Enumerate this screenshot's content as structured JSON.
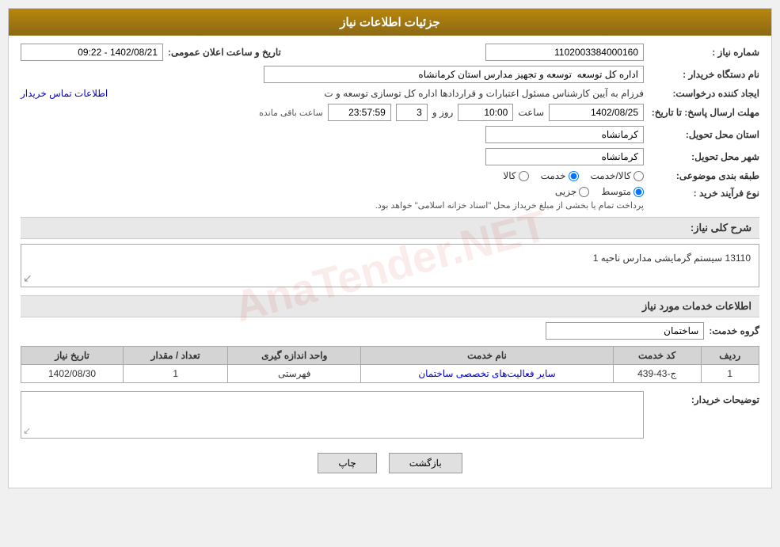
{
  "header": {
    "title": "جزئیات اطلاعات نیاز"
  },
  "fields": {
    "shomareNiaz_label": "شماره نیاز :",
    "shomareNiaz_value": "1102003384000160",
    "namDastgah_label": "نام دستگاه خریدار :",
    "namDastgah_value": "اداره کل توسعه  توسعه و تجهیز مدارس استان کرمانشاه",
    "ijadKonande_label": "ایجاد کننده درخواست:",
    "ijadKonande_value": "فرزام به آیین کارشناس مسئول اعتبارات و قراردادها اداره کل توسازی  توسعه و ت",
    "ijadKonande_link": "اطلاعات تماس خریدار",
    "mohlat_label": "مهلت ارسال پاسخ: تا تاریخ:",
    "date_value": "1402/08/25",
    "saat_label": "ساعت",
    "saat_value": "10:00",
    "rooz_label": "روز و",
    "rooz_value": "3",
    "remaining_label": "ساعت باقی مانده",
    "remaining_value": "23:57:59",
    "ostan_label": "استان محل تحویل:",
    "ostan_value": "کرمانشاه",
    "shahr_label": "شهر محل تحویل:",
    "shahr_value": "کرمانشاه",
    "tabaqe_label": "طبقه بندی موضوعی:",
    "tabaqe_kala": "کالا",
    "tabaqe_khedmat": "خدمت",
    "tabaqe_kala_khedmat": "کالا/خدمت",
    "tabaqe_selected": "khedmat",
    "noeFarayand_label": "نوع فرآیند خرید :",
    "noeFarayand_jozii": "جزیی",
    "noeFarayand_motavasset": "متوسط",
    "noeFarayand_note": "پرداخت تمام یا بخشی از مبلغ خریداز محل \"اسناد خزانه اسلامی\" خواهد بود.",
    "noeFarayand_selected": "motavasset",
    "tanhNiaz_label": "شرح کلی نیاز:",
    "tanhNiaz_value": "13110 سیستم گرمایشی مدارس ناحیه 1",
    "khAdamat_label": "اطلاعات خدمات مورد نیاز",
    "grohKhedmat_label": "گروه خدمت:",
    "grohKhedmat_value": "ساختمان",
    "table": {
      "headers": [
        "ردیف",
        "کد خدمت",
        "نام خدمت",
        "واحد اندازه گیری",
        "تعداد / مقدار",
        "تاریخ نیاز"
      ],
      "rows": [
        {
          "radif": "1",
          "kodKhedmat": "ج-43-439",
          "namKhedmat": "سایر فعالیت‌های تخصصی ساختمان",
          "vahed": "فهرستی",
          "tedad": "1",
          "tarikh": "1402/08/30"
        }
      ]
    },
    "tawzihKharidar_label": "توضیحات خریدار:",
    "tawzihKharidar_value": "",
    "tarikh_saat_elan_label": "تاریخ و ساعت اعلان عمومی:",
    "tarikh_saat_elan_value": "1402/08/21 - 09:22",
    "buttons": {
      "back": "بازگشت",
      "print": "چاپ"
    }
  }
}
